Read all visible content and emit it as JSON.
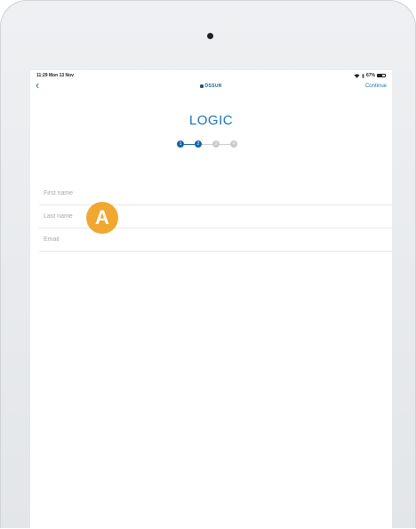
{
  "status_bar": {
    "time": "11:29 Mon 13 Nov",
    "battery": "67%",
    "battery_level": 0.67
  },
  "nav": {
    "back_icon": "chevron-left-icon",
    "back_glyph": "‹",
    "brand": "ÖSSUR",
    "continue_label": "Continue"
  },
  "title": "LOGIC",
  "stepper": {
    "steps": [
      "1",
      "2",
      "3",
      "4"
    ],
    "current_step": 2
  },
  "form": {
    "first_name": {
      "placeholder": "First name",
      "value": ""
    },
    "last_name": {
      "placeholder": "Last name",
      "value": ""
    },
    "email": {
      "placeholder": "Email",
      "value": ""
    }
  },
  "annotation": {
    "label": "A",
    "color": "#f0a830"
  },
  "colors": {
    "accent": "#1a73b9",
    "step_active": "#1664a7",
    "step_inactive": "#c9cbcd"
  }
}
